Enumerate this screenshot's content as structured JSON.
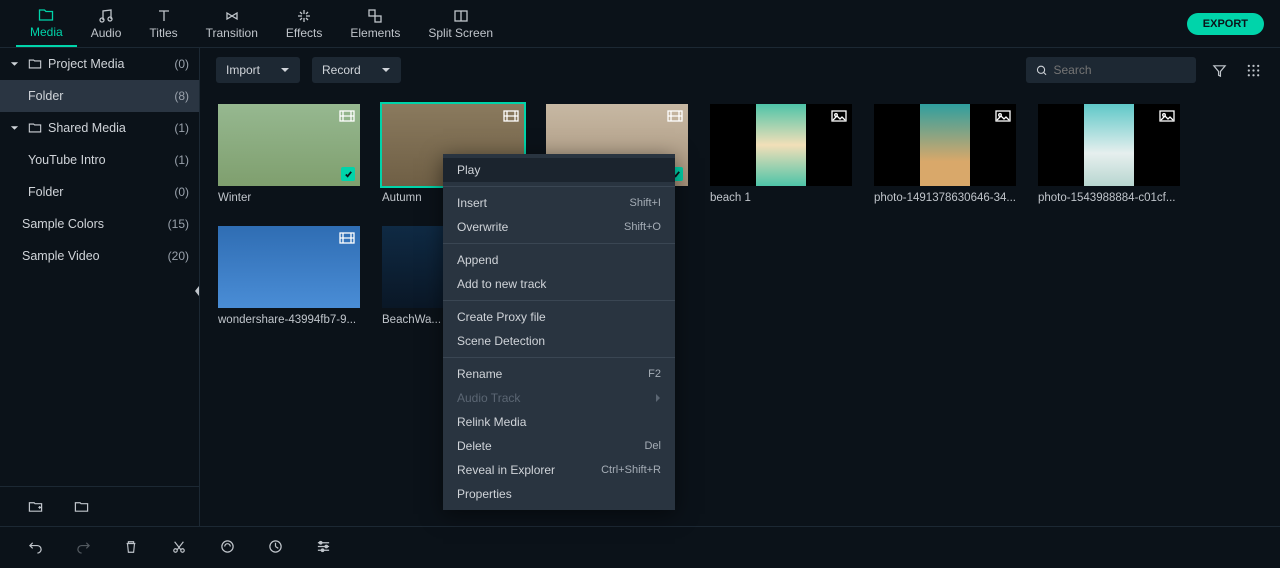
{
  "tabs": [
    {
      "label": "Media"
    },
    {
      "label": "Audio"
    },
    {
      "label": "Titles"
    },
    {
      "label": "Transition"
    },
    {
      "label": "Effects"
    },
    {
      "label": "Elements"
    },
    {
      "label": "Split Screen"
    }
  ],
  "export_label": "EXPORT",
  "sidebar": [
    {
      "label": "Project Media",
      "count": "(0)",
      "chevron": true,
      "folder": true
    },
    {
      "label": "Folder",
      "count": "(8)",
      "selected": true,
      "indent": 1
    },
    {
      "label": "Shared Media",
      "count": "(1)",
      "chevron": true,
      "folder": true
    },
    {
      "label": "YouTube Intro",
      "count": "(1)",
      "indent": 1
    },
    {
      "label": "Folder",
      "count": "(0)",
      "indent": 1
    },
    {
      "label": "Sample Colors",
      "count": "(15)"
    },
    {
      "label": "Sample Video",
      "count": "(20)"
    }
  ],
  "import_label": "Import",
  "record_label": "Record",
  "search_placeholder": "Search",
  "clips": [
    {
      "name": "Winter",
      "kind": "video",
      "checked": true,
      "thumb": "fake"
    },
    {
      "name": "Autumn",
      "kind": "video",
      "checked": true,
      "selected": true,
      "thumb": "fake autumn"
    },
    {
      "name": "",
      "kind": "video",
      "checked": true,
      "thumb": "fake girl"
    },
    {
      "name": "beach 1",
      "kind": "image",
      "thumb": "fake beach"
    },
    {
      "name": "photo-1491378630646-34...",
      "kind": "image",
      "thumb": "fake beach2"
    },
    {
      "name": "photo-1543988884-c01cf...",
      "kind": "image",
      "thumb": "fake beach3"
    },
    {
      "name": "wondershare-43994fb7-9...",
      "kind": "video",
      "thumb": "fake waves"
    },
    {
      "name": "BeachWa...",
      "kind": "video",
      "thumb": "fake bw"
    }
  ],
  "context_menu": [
    {
      "label": "Play",
      "selected": true
    },
    {
      "sep": true
    },
    {
      "label": "Insert",
      "shortcut": "Shift+I"
    },
    {
      "label": "Overwrite",
      "shortcut": "Shift+O"
    },
    {
      "sep": true
    },
    {
      "label": "Append"
    },
    {
      "label": "Add to new track"
    },
    {
      "sep": true
    },
    {
      "label": "Create Proxy file"
    },
    {
      "label": "Scene Detection"
    },
    {
      "sep": true
    },
    {
      "label": "Rename",
      "shortcut": "F2"
    },
    {
      "label": "Audio Track",
      "disabled": true,
      "submenu": true
    },
    {
      "label": "Relink Media"
    },
    {
      "label": "Delete",
      "shortcut": "Del"
    },
    {
      "label": "Reveal in Explorer",
      "shortcut": "Ctrl+Shift+R"
    },
    {
      "label": "Properties"
    }
  ]
}
